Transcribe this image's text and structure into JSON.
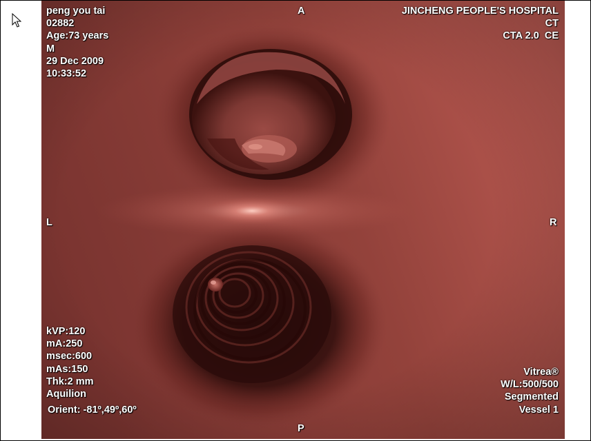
{
  "patient": {
    "name": "peng you tai",
    "id": "02882",
    "age": "Age:73 years",
    "sex": "M",
    "date": "29 Dec 2009",
    "time": "10:33:52"
  },
  "institution": {
    "hospital": "JINCHENG PEOPLE'S HOSPITAL",
    "modality": "CT",
    "protocol": "CTA 2.0  CE"
  },
  "acquisition": {
    "kvp": "kVP:120",
    "ma": "mA:250",
    "msec": "msec:600",
    "mas": "mAs:150",
    "thickness": "Thk:2 mm",
    "scanner": "Aquilion",
    "orientation": "Orient: -81º,49º,60º"
  },
  "render": {
    "software": "Vitrea®",
    "window_level": "W/L:500/500",
    "mode": "Segmented",
    "object": "Vessel 1"
  },
  "markers": {
    "anterior": "A",
    "posterior": "P",
    "left": "L",
    "right": "R"
  },
  "colors": {
    "tissue_base": "#8e3e38",
    "tissue_light": "#c25a52",
    "lumen_dark": "#2a0b09",
    "highlight": "#ffc4b8"
  },
  "icons": {
    "cursor": "mouse-pointer-icon"
  }
}
